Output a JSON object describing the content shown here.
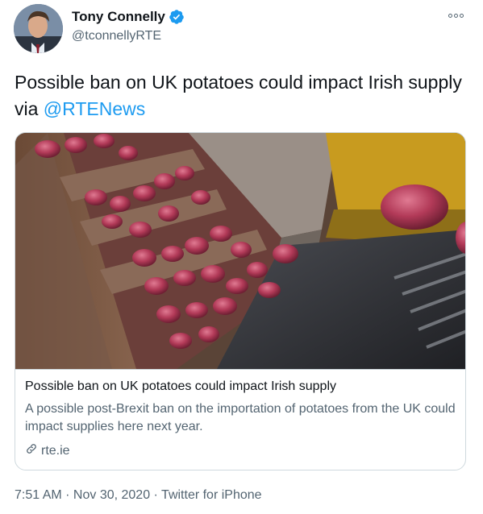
{
  "author": {
    "display_name": "Tony Connelly",
    "handle": "@tconnellyRTE",
    "verified": true
  },
  "tweet": {
    "text_prefix": "Possible ban on UK potatoes could impact Irish supply via ",
    "mention": "@RTENews"
  },
  "card": {
    "title": "Possible ban on UK potatoes could impact Irish supply",
    "description": "A possible post-Brexit ban on the importation of potatoes from the UK could impact supplies here next year.",
    "domain": "rte.ie"
  },
  "meta": {
    "time": "7:51 AM",
    "separator": " · ",
    "date": "Nov 30, 2020",
    "source": "Twitter for iPhone"
  },
  "colors": {
    "accent": "#1d9bf0",
    "secondary_text": "#536471",
    "border": "#cfd9de"
  }
}
